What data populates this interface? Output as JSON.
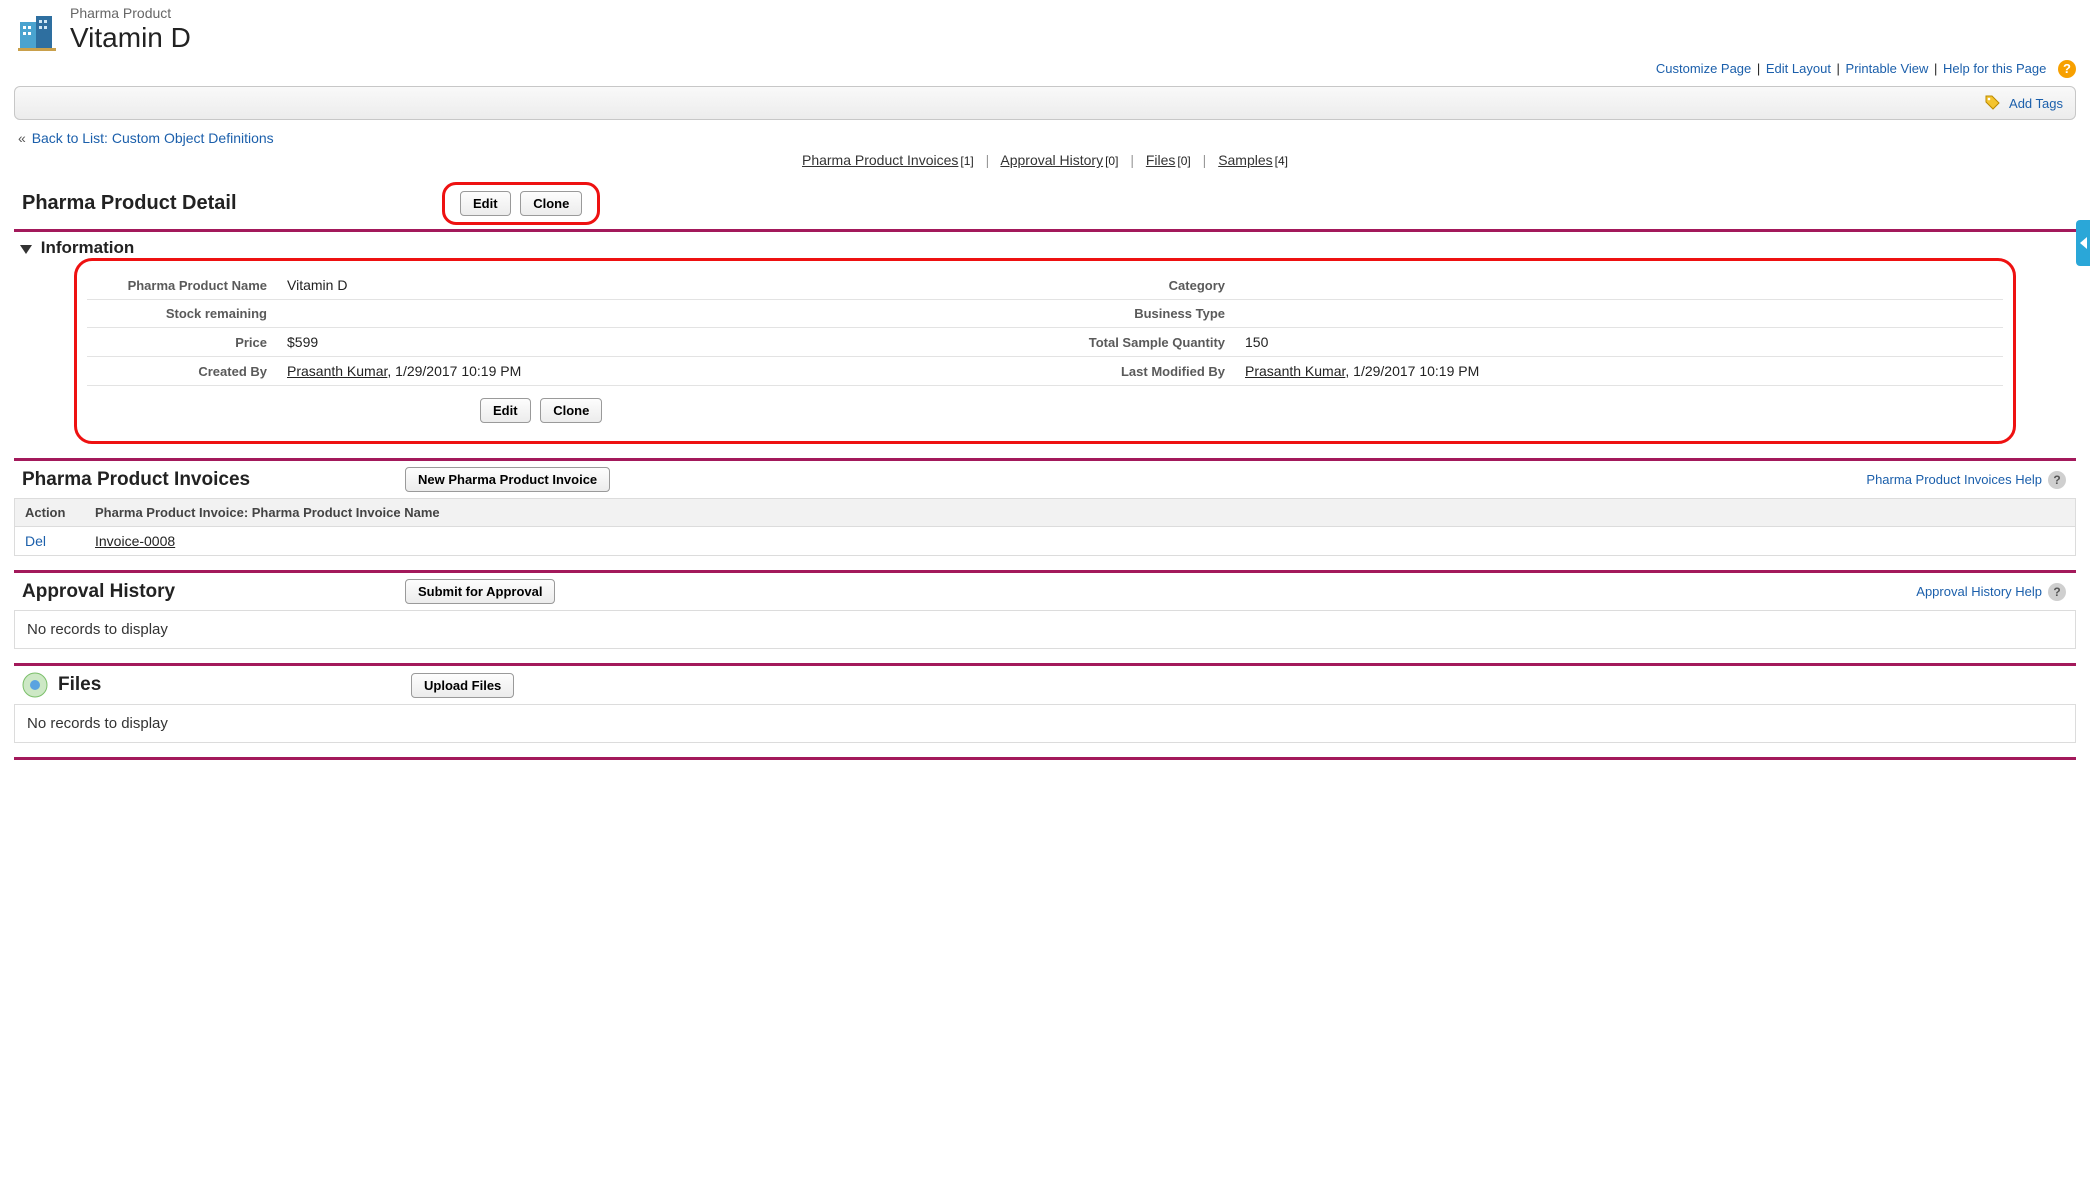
{
  "header": {
    "object_type": "Pharma Product",
    "record_title": "Vitamin D"
  },
  "top_links": {
    "customize": "Customize Page",
    "edit_layout": "Edit Layout",
    "printable": "Printable View",
    "help": "Help for this Page"
  },
  "tags_bar": {
    "add_tags": "Add Tags"
  },
  "backlink": {
    "prefix": "«",
    "label": "Back to List: Custom Object Definitions"
  },
  "related_nav": {
    "items": [
      {
        "label": "Pharma Product Invoices",
        "count": "[1]"
      },
      {
        "label": "Approval History",
        "count": "[0]"
      },
      {
        "label": "Files",
        "count": "[0]"
      },
      {
        "label": "Samples",
        "count": "[4]"
      }
    ]
  },
  "detail": {
    "title": "Pharma Product Detail",
    "edit_label": "Edit",
    "clone_label": "Clone",
    "section_title": "Information",
    "fields": {
      "name_label": "Pharma Product Name",
      "name_value": "Vitamin D",
      "category_label": "Category",
      "category_value": "",
      "stock_label": "Stock remaining",
      "stock_value": "",
      "btype_label": "Business Type",
      "btype_value": "",
      "price_label": "Price",
      "price_value": "$599",
      "tsq_label": "Total Sample Quantity",
      "tsq_value": "150",
      "created_label": "Created By",
      "created_user": "Prasanth Kumar",
      "created_time": ", 1/29/2017 10:19 PM",
      "modified_label": "Last Modified By",
      "modified_user": "Prasanth Kumar",
      "modified_time": ", 1/29/2017 10:19 PM"
    }
  },
  "rl_invoices": {
    "title": "Pharma Product Invoices",
    "new_button": "New Pharma Product Invoice",
    "help_link": "Pharma Product Invoices Help",
    "col_action": "Action",
    "col_name": "Pharma Product Invoice: Pharma Product Invoice Name",
    "row_action": "Del",
    "row_name": "Invoice-0008"
  },
  "rl_approval": {
    "title": "Approval History",
    "button": "Submit for Approval",
    "help_link": "Approval History Help",
    "empty": "No records to display"
  },
  "rl_files": {
    "title": "Files",
    "button": "Upload Files",
    "empty": "No records to display"
  }
}
